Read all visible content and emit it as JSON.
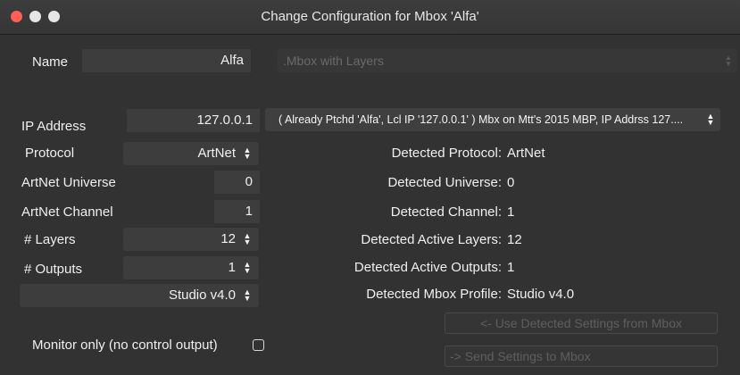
{
  "window": {
    "title": "Change Configuration for Mbox 'Alfa'"
  },
  "name": {
    "label": "Name",
    "value": "Alfa"
  },
  "mbox_type_popup": {
    "value": ".Mbox with Layers"
  },
  "ip_address": {
    "label": "IP Address",
    "value": "127.0.0.1"
  },
  "detected_mbox_popup": {
    "value": "( Already Ptchd 'Alfa', Lcl IP '127.0.0.1' ) Mbx on Mtt's 2015 MBP, IP Addrss 127...."
  },
  "protocol": {
    "label": "Protocol",
    "value": "ArtNet"
  },
  "artnet_universe": {
    "label": "ArtNet Universe",
    "value": "0"
  },
  "artnet_channel": {
    "label": "ArtNet Channel",
    "value": "1"
  },
  "layers": {
    "label": "# Layers",
    "value": "12"
  },
  "outputs": {
    "label": "# Outputs",
    "value": "1"
  },
  "profile": {
    "value": "Studio v4.0"
  },
  "detected": {
    "protocol": {
      "label": "Detected Protocol:",
      "value": "ArtNet"
    },
    "universe": {
      "label": "Detected Universe:",
      "value": "0"
    },
    "channel": {
      "label": "Detected Channel:",
      "value": "1"
    },
    "layers": {
      "label": "Detected Active Layers:",
      "value": "12"
    },
    "outputs": {
      "label": "Detected Active Outputs:",
      "value": "1"
    },
    "profile": {
      "label": "Detected Mbox Profile:",
      "value": "Studio v4.0"
    }
  },
  "buttons": {
    "use_detected": "<- Use Detected Settings from Mbox",
    "send_settings": "-> Send Settings to Mbox"
  },
  "monitor_only": {
    "label": "Monitor only (no control output)",
    "checked": false
  },
  "colors": {
    "background": "#323232",
    "close_button": "#fc5f57",
    "field_bg": "#3d3d3d",
    "disabled_text": "#5f5f5f"
  }
}
